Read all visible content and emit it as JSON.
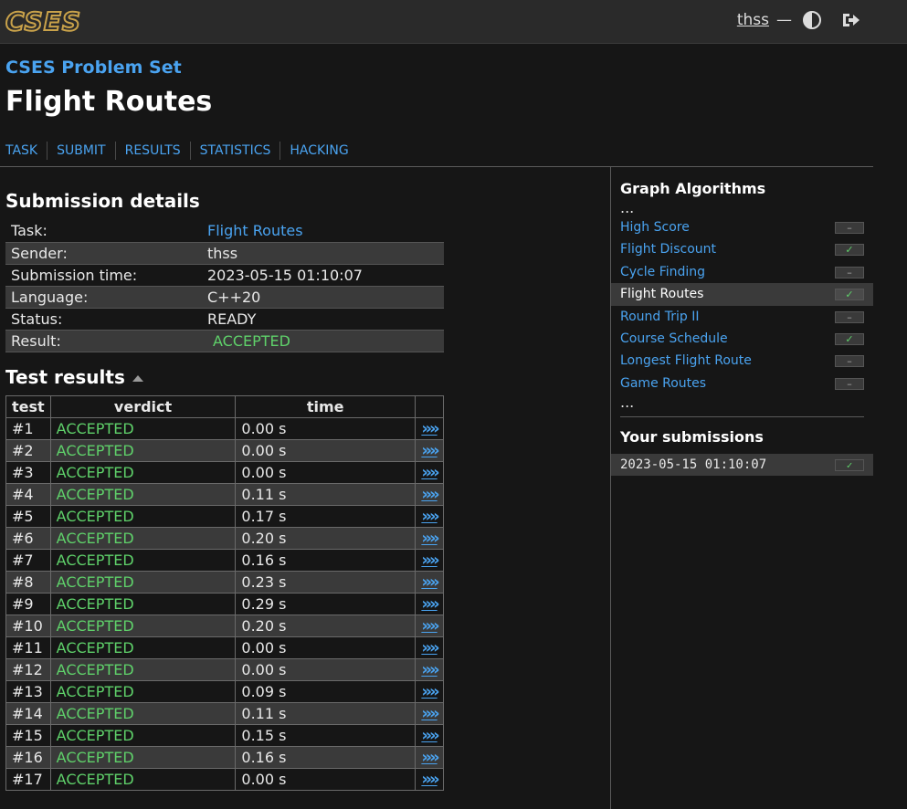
{
  "header": {
    "logo_text": "CSES",
    "username": "thss",
    "dash": "—",
    "theme_icon": "contrast-icon",
    "logout_icon": "logout-icon"
  },
  "site_title": "CSES Problem Set",
  "page_title": "Flight Routes",
  "nav": [
    "TASK",
    "SUBMIT",
    "RESULTS",
    "STATISTICS",
    "HACKING"
  ],
  "details": {
    "heading": "Submission details",
    "task_label": "Task:",
    "task_value": "Flight Routes",
    "sender_label": "Sender:",
    "sender_value": "thss",
    "time_label": "Submission time:",
    "time_value": "2023-05-15 01:10:07",
    "language_label": "Language:",
    "language_value": "C++20",
    "status_label": "Status:",
    "status_value": "READY",
    "result_label": "Result:",
    "result_value": "ACCEPTED"
  },
  "results": {
    "heading": "Test results",
    "columns": [
      "test",
      "verdict",
      "time"
    ],
    "rows": [
      {
        "test": "#1",
        "verdict": "ACCEPTED",
        "time": "0.00 s"
      },
      {
        "test": "#2",
        "verdict": "ACCEPTED",
        "time": "0.00 s"
      },
      {
        "test": "#3",
        "verdict": "ACCEPTED",
        "time": "0.00 s"
      },
      {
        "test": "#4",
        "verdict": "ACCEPTED",
        "time": "0.11 s"
      },
      {
        "test": "#5",
        "verdict": "ACCEPTED",
        "time": "0.17 s"
      },
      {
        "test": "#6",
        "verdict": "ACCEPTED",
        "time": "0.20 s"
      },
      {
        "test": "#7",
        "verdict": "ACCEPTED",
        "time": "0.16 s"
      },
      {
        "test": "#8",
        "verdict": "ACCEPTED",
        "time": "0.23 s"
      },
      {
        "test": "#9",
        "verdict": "ACCEPTED",
        "time": "0.29 s"
      },
      {
        "test": "#10",
        "verdict": "ACCEPTED",
        "time": "0.20 s"
      },
      {
        "test": "#11",
        "verdict": "ACCEPTED",
        "time": "0.00 s"
      },
      {
        "test": "#12",
        "verdict": "ACCEPTED",
        "time": "0.00 s"
      },
      {
        "test": "#13",
        "verdict": "ACCEPTED",
        "time": "0.09 s"
      },
      {
        "test": "#14",
        "verdict": "ACCEPTED",
        "time": "0.11 s"
      },
      {
        "test": "#15",
        "verdict": "ACCEPTED",
        "time": "0.15 s"
      },
      {
        "test": "#16",
        "verdict": "ACCEPTED",
        "time": "0.16 s"
      },
      {
        "test": "#17",
        "verdict": "ACCEPTED",
        "time": "0.00 s"
      }
    ],
    "link_glyph": "»"
  },
  "sidebar": {
    "heading": "Graph Algorithms",
    "ellipsis": "...",
    "tasks": [
      {
        "name": "High Score",
        "status": "none",
        "current": false
      },
      {
        "name": "Flight Discount",
        "status": "ok",
        "current": false
      },
      {
        "name": "Cycle Finding",
        "status": "none",
        "current": false
      },
      {
        "name": "Flight Routes",
        "status": "ok",
        "current": true
      },
      {
        "name": "Round Trip II",
        "status": "none",
        "current": false
      },
      {
        "name": "Course Schedule",
        "status": "ok",
        "current": false
      },
      {
        "name": "Longest Flight Route",
        "status": "none",
        "current": false
      },
      {
        "name": "Game Routes",
        "status": "none",
        "current": false
      }
    ],
    "status_glyphs": {
      "none": "–",
      "ok": "✓"
    },
    "submissions_heading": "Your submissions",
    "submissions": [
      {
        "time": "2023-05-15 01:10:07",
        "status": "ok"
      }
    ]
  },
  "colors": {
    "link": "#4aa3f0",
    "accepted": "#5fd16a",
    "logo": "#c9a24a",
    "background": "#161616"
  }
}
